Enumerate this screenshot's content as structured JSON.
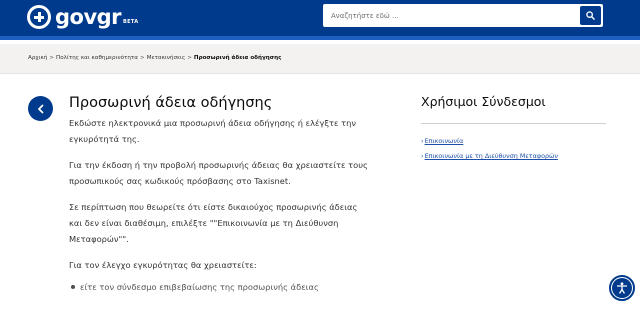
{
  "header": {
    "logo_text": "govgr",
    "logo_badge": "BETA",
    "search_placeholder": "Αναζητήστε εδώ ...",
    "colors": {
      "primary": "#003a8c",
      "accent_border": "#1f5fc1",
      "link": "#1d4fa8"
    }
  },
  "breadcrumb": {
    "items": [
      "Αρχική",
      "Πολίτης και καθημερινότητα",
      "Μετακινήσεις"
    ],
    "separator": ">",
    "current": "Προσωρινή άδεια οδήγησης"
  },
  "main": {
    "title": "Προσωρινή άδεια οδήγησης",
    "paragraphs": [
      "Εκδώστε ηλεκτρονικά μια προσωρινή άδεια οδήγησης ή ελέγξτε την εγκυρότητά της.",
      "Για την έκδοση ή την προβολή προσωρινής άδειας θα χρειαστείτε τους προσωπικούς σας κωδικούς πρόσβασης στο Taxisnet.",
      "Σε περίπτωση που θεωρείτε ότι είστε δικαιούχος προσωρινής άδειας και δεν είναι διαθέσιμη, επιλέξτε \"\"Επικοινωνία με τη Διεύθυνση Μεταφορών\"\".",
      "Για τον έλεγχο εγκυρότητας θα χρειαστείτε:"
    ],
    "bullets": [
      "είτε τον σύνδεσμο επιβεβαίωσης της προσωρινής άδειας"
    ]
  },
  "sidebar": {
    "title": "Χρήσιμοι Σύνδεσμοι",
    "links": [
      "Επικοινωνία",
      "Επικοινωνία με τη Διεύθυνση Μεταφορών"
    ]
  },
  "icons": {
    "back": "chevron-left-icon",
    "search": "search-icon",
    "accessibility": "accessibility-icon"
  }
}
